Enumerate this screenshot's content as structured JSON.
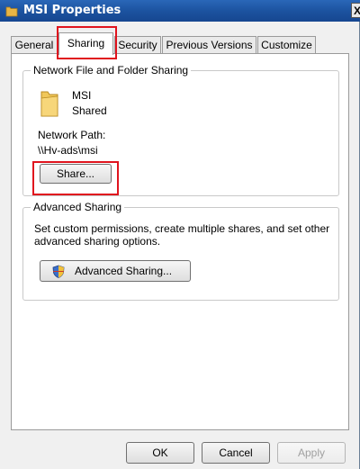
{
  "window": {
    "title": "MSI Properties",
    "close_glyph": "X"
  },
  "tabs": [
    {
      "label": "General"
    },
    {
      "label": "Sharing",
      "active": true
    },
    {
      "label": "Security"
    },
    {
      "label": "Previous Versions"
    },
    {
      "label": "Customize"
    }
  ],
  "network_sharing": {
    "group_title": "Network File and Folder Sharing",
    "folder_name": "MSI",
    "status": "Shared",
    "path_label": "Network Path:",
    "path_value": "\\\\Hv-ads\\msi",
    "share_button": "Share..."
  },
  "advanced_sharing": {
    "group_title": "Advanced Sharing",
    "description_line1": "Set custom permissions, create multiple shares, and set other",
    "description_line2": "advanced sharing options.",
    "button_label": "Advanced Sharing..."
  },
  "footer": {
    "ok": "OK",
    "cancel": "Cancel",
    "apply": "Apply"
  },
  "colors": {
    "highlight": "#e0141e",
    "titlebar": "#1c53a0"
  },
  "icons": {
    "title": "folder-icon",
    "folder": "folder-icon",
    "advanced": "shield-icon"
  }
}
